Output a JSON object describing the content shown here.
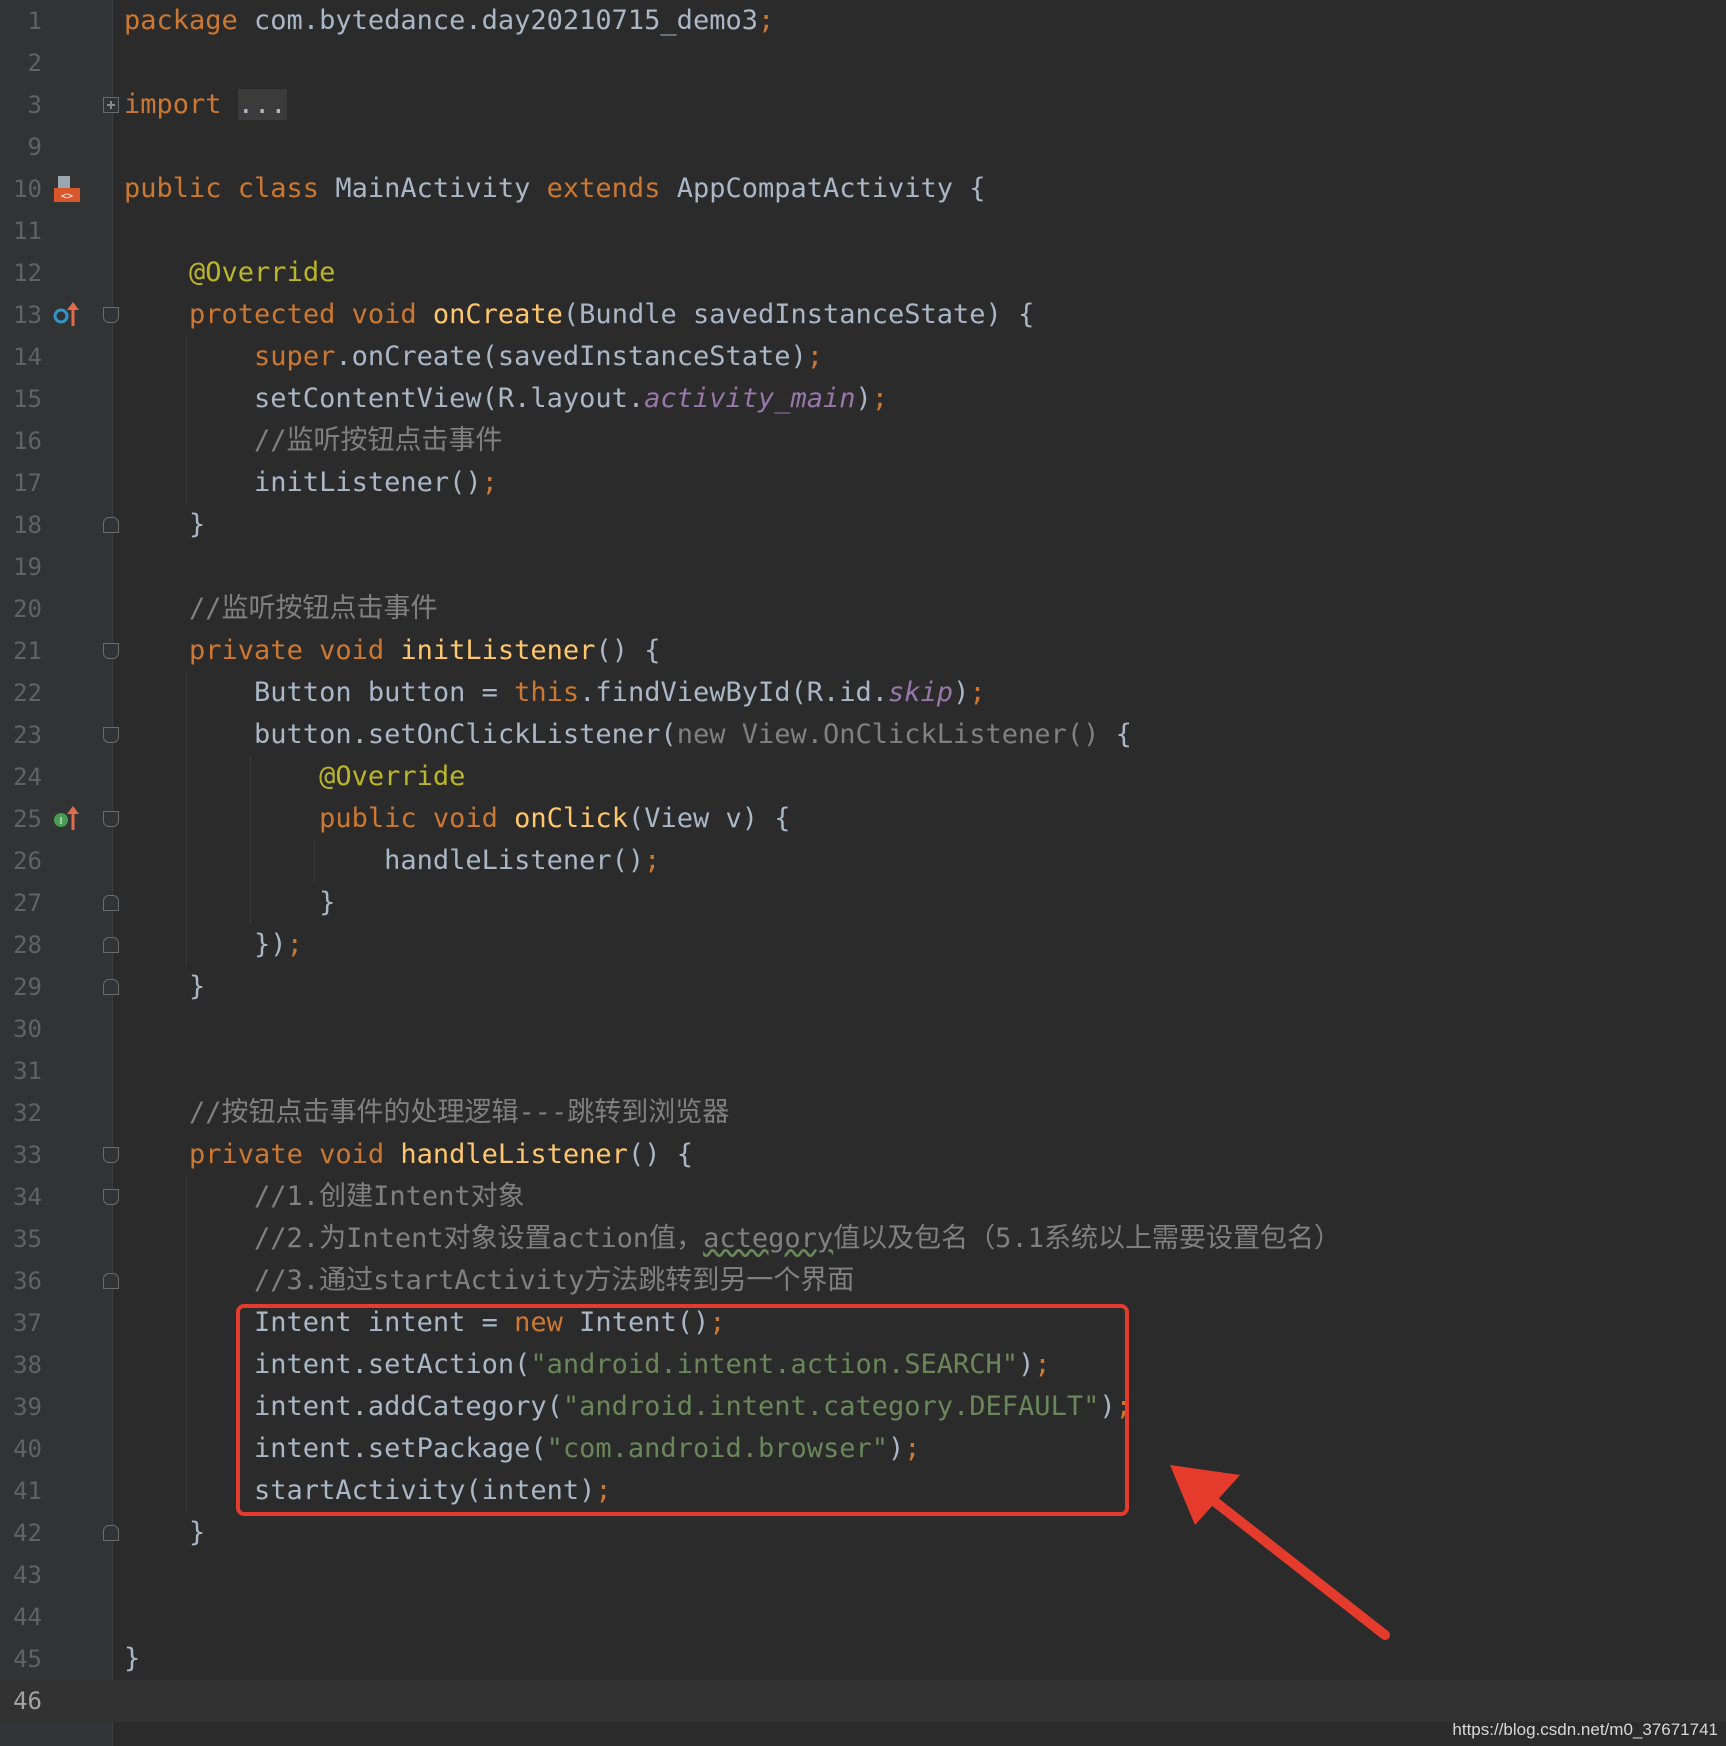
{
  "editor": {
    "line_numbers": [
      "1",
      "2",
      "3",
      "9",
      "10",
      "11",
      "12",
      "13",
      "14",
      "15",
      "16",
      "17",
      "18",
      "19",
      "20",
      "21",
      "22",
      "23",
      "24",
      "25",
      "26",
      "27",
      "28",
      "29",
      "30",
      "31",
      "32",
      "33",
      "34",
      "35",
      "36",
      "37",
      "38",
      "39",
      "40",
      "41",
      "42",
      "43",
      "44",
      "45",
      "46"
    ],
    "lines": [
      {
        "ln": "1",
        "tokens": [
          [
            "kw",
            "package "
          ],
          [
            "pln",
            "com.bytedance.day20210715_demo3"
          ],
          [
            "semi",
            ";"
          ]
        ]
      },
      {
        "ln": "2",
        "tokens": []
      },
      {
        "ln": "3",
        "tokens": [
          [
            "kw",
            "import "
          ],
          [
            "fold",
            "..."
          ]
        ]
      },
      {
        "ln": "9",
        "tokens": []
      },
      {
        "ln": "10",
        "tokens": [
          [
            "kw",
            "public class "
          ],
          [
            "pln",
            "MainActivity "
          ],
          [
            "kw",
            "extends "
          ],
          [
            "pln",
            "AppCompatActivity {"
          ]
        ]
      },
      {
        "ln": "11",
        "tokens": []
      },
      {
        "ln": "12",
        "tokens": [
          [
            "pln",
            "    "
          ],
          [
            "ann",
            "@Override"
          ]
        ]
      },
      {
        "ln": "13",
        "tokens": [
          [
            "pln",
            "    "
          ],
          [
            "kw",
            "protected void "
          ],
          [
            "fn",
            "onCreate"
          ],
          [
            "pln",
            "(Bundle savedInstanceState) {"
          ]
        ]
      },
      {
        "ln": "14",
        "tokens": [
          [
            "pln",
            "        "
          ],
          [
            "kw",
            "super"
          ],
          [
            "pln",
            ".onCreate(savedInstanceState)"
          ],
          [
            "semi",
            ";"
          ]
        ]
      },
      {
        "ln": "15",
        "tokens": [
          [
            "pln",
            "        setContentView(R.layout."
          ],
          [
            "fld",
            "activity_main"
          ],
          [
            "pln",
            ")"
          ],
          [
            "semi",
            ";"
          ]
        ]
      },
      {
        "ln": "16",
        "tokens": [
          [
            "pln",
            "        "
          ],
          [
            "cmt",
            "//监听按钮点击事件"
          ]
        ]
      },
      {
        "ln": "17",
        "tokens": [
          [
            "pln",
            "        initListener()"
          ],
          [
            "semi",
            ";"
          ]
        ]
      },
      {
        "ln": "18",
        "tokens": [
          [
            "pln",
            "    }"
          ]
        ]
      },
      {
        "ln": "19",
        "tokens": []
      },
      {
        "ln": "20",
        "tokens": [
          [
            "pln",
            "    "
          ],
          [
            "cmt",
            "//监听按钮点击事件"
          ]
        ]
      },
      {
        "ln": "21",
        "tokens": [
          [
            "pln",
            "    "
          ],
          [
            "kw",
            "private void "
          ],
          [
            "fn",
            "initListener"
          ],
          [
            "pln",
            "() {"
          ]
        ]
      },
      {
        "ln": "22",
        "tokens": [
          [
            "pln",
            "        Button button = "
          ],
          [
            "kw",
            "this"
          ],
          [
            "pln",
            ".findViewById(R.id."
          ],
          [
            "fld",
            "skip"
          ],
          [
            "pln",
            ")"
          ],
          [
            "semi",
            ";"
          ]
        ]
      },
      {
        "ln": "23",
        "tokens": [
          [
            "pln",
            "        button.setOnClickListener("
          ],
          [
            "dim",
            "new View.OnClickListener() "
          ],
          [
            "pln",
            "{"
          ]
        ]
      },
      {
        "ln": "24",
        "tokens": [
          [
            "pln",
            "            "
          ],
          [
            "ann",
            "@Override"
          ]
        ]
      },
      {
        "ln": "25",
        "tokens": [
          [
            "pln",
            "            "
          ],
          [
            "kw",
            "public void "
          ],
          [
            "fn",
            "onClick"
          ],
          [
            "pln",
            "(View v) {"
          ]
        ]
      },
      {
        "ln": "26",
        "tokens": [
          [
            "pln",
            "                handleListener()"
          ],
          [
            "semi",
            ";"
          ]
        ]
      },
      {
        "ln": "27",
        "tokens": [
          [
            "pln",
            "            }"
          ]
        ]
      },
      {
        "ln": "28",
        "tokens": [
          [
            "pln",
            "        })"
          ],
          [
            "semi",
            ";"
          ]
        ]
      },
      {
        "ln": "29",
        "tokens": [
          [
            "pln",
            "    }"
          ]
        ]
      },
      {
        "ln": "30",
        "tokens": []
      },
      {
        "ln": "31",
        "tokens": []
      },
      {
        "ln": "32",
        "tokens": [
          [
            "pln",
            "    "
          ],
          [
            "cmt",
            "//按钮点击事件的处理逻辑---跳转到浏览器"
          ]
        ]
      },
      {
        "ln": "33",
        "tokens": [
          [
            "pln",
            "    "
          ],
          [
            "kw",
            "private void "
          ],
          [
            "fn",
            "handleListener"
          ],
          [
            "pln",
            "() {"
          ]
        ]
      },
      {
        "ln": "34",
        "tokens": [
          [
            "pln",
            "        "
          ],
          [
            "cmt",
            "//1.创建Intent对象"
          ]
        ]
      },
      {
        "ln": "35",
        "tokens": [
          [
            "pln",
            "        "
          ],
          [
            "cmt",
            "//2.为Intent对象设置action值，"
          ],
          [
            "cmt_typo",
            "actegory"
          ],
          [
            "cmt",
            "值以及包名（5.1系统以上需要设置包名）"
          ]
        ]
      },
      {
        "ln": "36",
        "tokens": [
          [
            "pln",
            "        "
          ],
          [
            "cmt",
            "//3.通过startActivity方法跳转到另一个界面"
          ]
        ]
      },
      {
        "ln": "37",
        "tokens": [
          [
            "pln",
            "        Intent intent = "
          ],
          [
            "kw",
            "new "
          ],
          [
            "pln",
            "Intent()"
          ],
          [
            "semi",
            ";"
          ]
        ]
      },
      {
        "ln": "38",
        "tokens": [
          [
            "pln",
            "        intent.setAction("
          ],
          [
            "str",
            "\"android.intent.action.SEARCH\""
          ],
          [
            "pln",
            ")"
          ],
          [
            "semi",
            ";"
          ]
        ]
      },
      {
        "ln": "39",
        "tokens": [
          [
            "pln",
            "        intent.addCategory("
          ],
          [
            "str",
            "\"android.intent.category.DEFAULT\""
          ],
          [
            "pln",
            ")"
          ],
          [
            "semi",
            ";"
          ]
        ]
      },
      {
        "ln": "40",
        "tokens": [
          [
            "pln",
            "        intent.setPackage("
          ],
          [
            "str",
            "\"com.android.browser\""
          ],
          [
            "pln",
            ")"
          ],
          [
            "semi",
            ";"
          ]
        ]
      },
      {
        "ln": "41",
        "tokens": [
          [
            "pln",
            "        startActivity(intent)"
          ],
          [
            "semi",
            ";"
          ]
        ]
      },
      {
        "ln": "42",
        "tokens": [
          [
            "pln",
            "    }"
          ]
        ]
      },
      {
        "ln": "43",
        "tokens": []
      },
      {
        "ln": "44",
        "tokens": []
      },
      {
        "ln": "45",
        "tokens": [
          [
            "pln",
            "}"
          ]
        ]
      },
      {
        "ln": "46",
        "tokens": []
      }
    ],
    "current_line": "46",
    "fold_markers": [
      {
        "ln": "3",
        "kind": "plus"
      },
      {
        "ln": "13",
        "kind": "open"
      },
      {
        "ln": "18",
        "kind": "close"
      },
      {
        "ln": "21",
        "kind": "open"
      },
      {
        "ln": "23",
        "kind": "open"
      },
      {
        "ln": "25",
        "kind": "open"
      },
      {
        "ln": "27",
        "kind": "close"
      },
      {
        "ln": "28",
        "kind": "close"
      },
      {
        "ln": "29",
        "kind": "close"
      },
      {
        "ln": "33",
        "kind": "open"
      },
      {
        "ln": "34",
        "kind": "open"
      },
      {
        "ln": "36",
        "kind": "close"
      },
      {
        "ln": "42",
        "kind": "close"
      }
    ],
    "gutter_icons": [
      {
        "ln": "10",
        "icon": "class-layout-icon"
      },
      {
        "ln": "13",
        "icon": "override-method-icon"
      },
      {
        "ln": "25",
        "icon": "implement-method-icon"
      }
    ]
  },
  "annotation": {
    "box_color": "#e53b2c",
    "box_lines": [
      "37",
      "41"
    ],
    "arrow_color": "#e53b2c"
  },
  "watermark": "https://blog.csdn.net/m0_37671741",
  "colors": {
    "background": "#2b2b2b",
    "gutter": "#313335",
    "keyword": "#cc7832",
    "function": "#ffc66d",
    "annotation": "#bbb529",
    "string": "#6a8759",
    "comment": "#808080",
    "field": "#9876aa",
    "text": "#a9b7c6"
  }
}
